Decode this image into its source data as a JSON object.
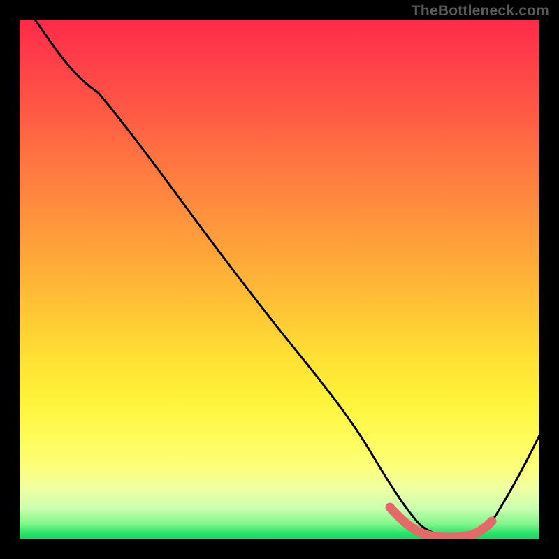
{
  "watermark": "TheBottleneck.com",
  "colors": {
    "background": "#000000",
    "gradient_top": "#ff2a4a",
    "gradient_bottom": "#17d765",
    "curve": "#000000",
    "highlight": "#e46a6a"
  },
  "chart_data": {
    "type": "line",
    "title": "",
    "xlabel": "",
    "ylabel": "",
    "xlim": [
      0,
      100
    ],
    "ylim": [
      0,
      100
    ],
    "series": [
      {
        "name": "bottleneck-curve",
        "x": [
          3,
          8,
          15,
          25,
          35,
          45,
          55,
          62,
          68,
          72,
          76,
          80,
          84,
          88,
          92,
          96,
          100
        ],
        "y": [
          100,
          94,
          86,
          73,
          60,
          47,
          34,
          25,
          16,
          10,
          5,
          2,
          0.5,
          0.5,
          2,
          8,
          20
        ]
      }
    ],
    "highlight_range": {
      "series": "bottleneck-curve",
      "x_start": 72,
      "x_end": 92,
      "note": "thick salmon segment near minimum"
    }
  }
}
